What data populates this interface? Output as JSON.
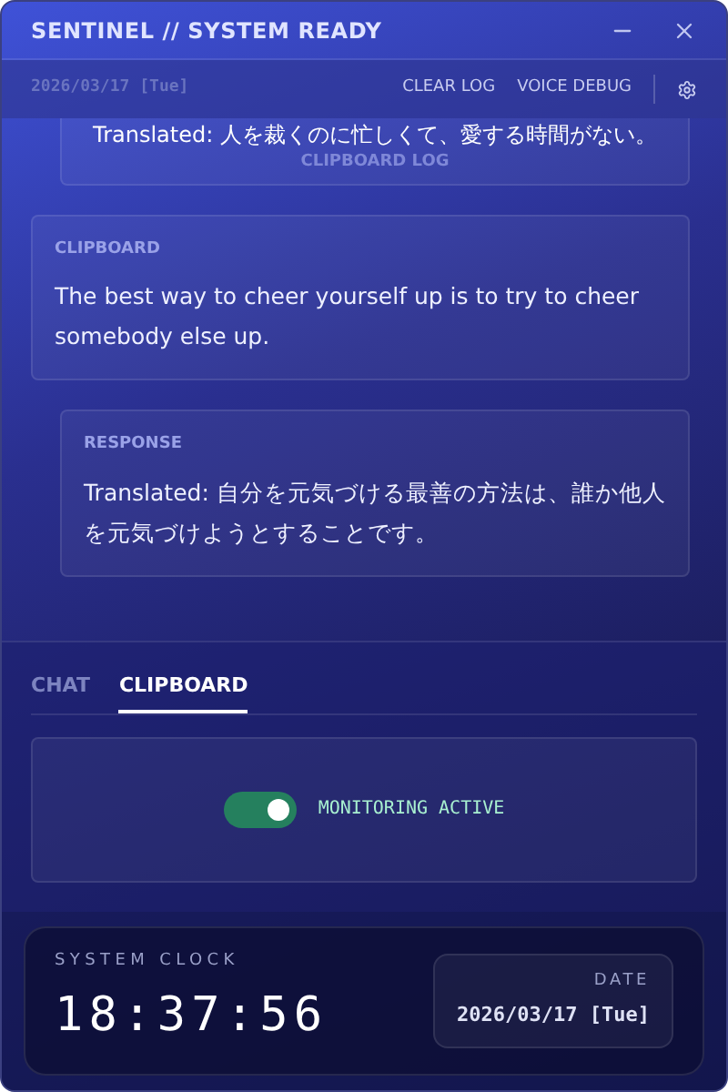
{
  "window": {
    "title": "SENTINEL // SYSTEM READY"
  },
  "toolbar": {
    "date": "2026/03/17 [Tue]",
    "buttons": [
      "CLEAR LOG",
      "VOICE DEBUG"
    ]
  },
  "log": {
    "section_label": "CLIPBOARD LOG",
    "entries": [
      {
        "kind": "response",
        "text": "Translated: 人を裁くのに忙しくて、愛する時間がない。"
      },
      {
        "kind": "clipboard",
        "label": "CLIPBOARD",
        "text": "The best way to cheer yourself up is to try to cheer somebody else up."
      },
      {
        "kind": "response",
        "label": "RESPONSE",
        "text": "Translated: 自分を元気づける最善の方法は、誰か他人を元気づけようとすることです。"
      }
    ]
  },
  "tabs": [
    {
      "label": "CHAT",
      "selected": false
    },
    {
      "label": "CLIPBOARD",
      "selected": true
    }
  ],
  "monitor": {
    "on": true,
    "label": "MONITORING ACTIVE"
  },
  "clock": {
    "label": "SYSTEM CLOCK",
    "time": "18:37:56",
    "date_label": "DATE",
    "date": "2026/03/17 [Tue]"
  }
}
